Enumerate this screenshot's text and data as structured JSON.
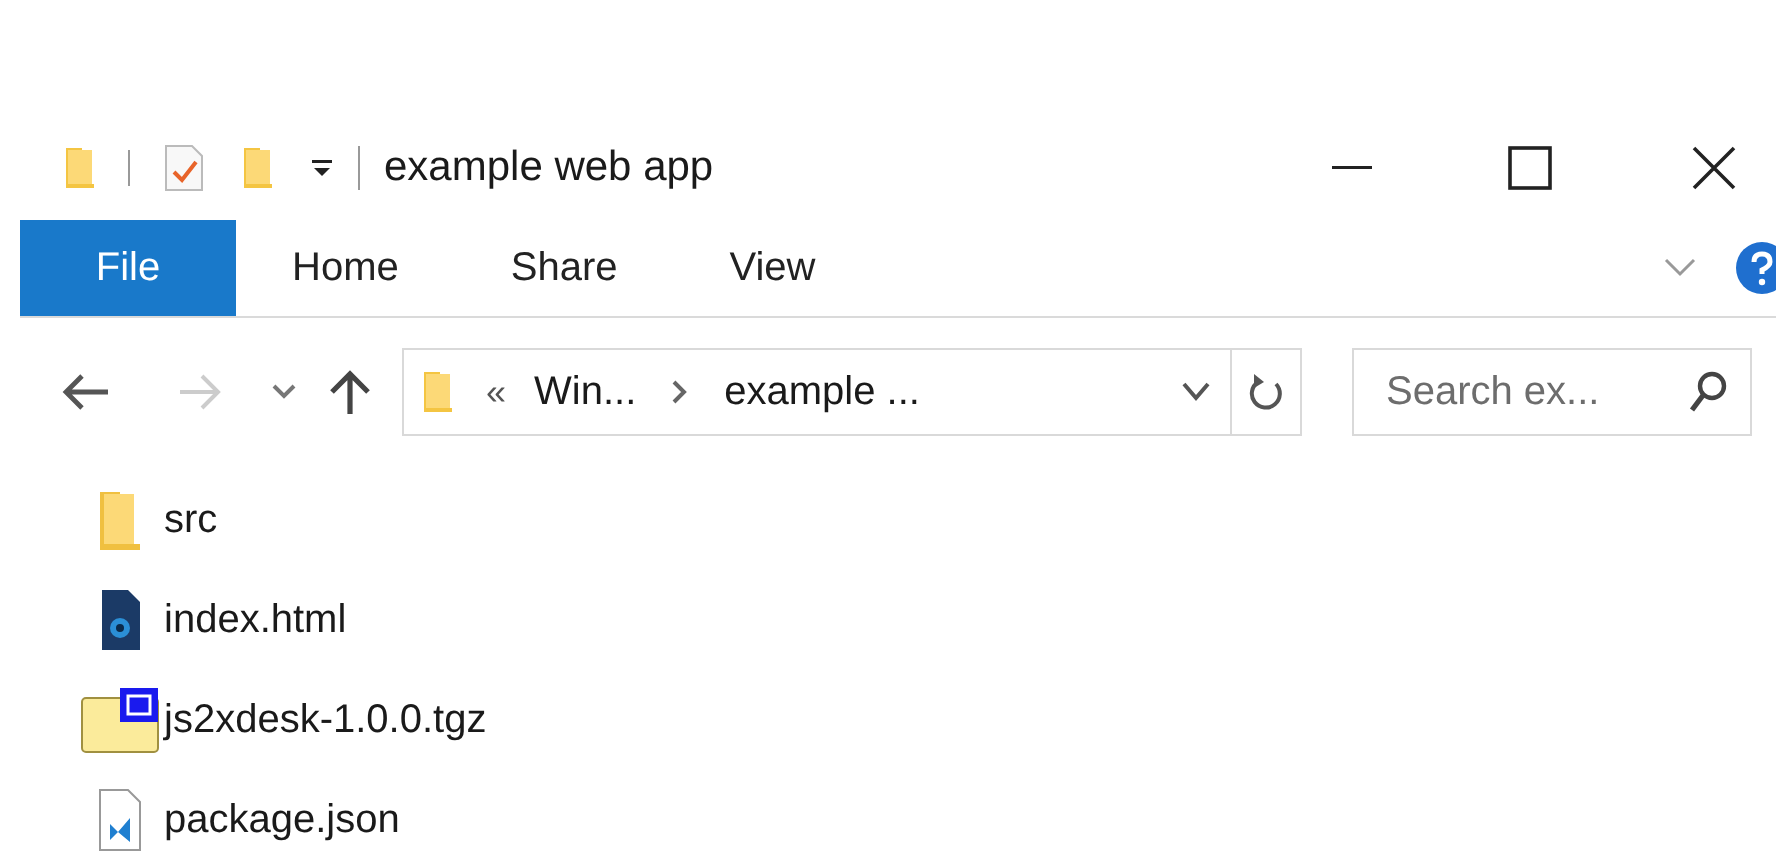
{
  "window": {
    "title": "example web app"
  },
  "ribbon": {
    "tabs": [
      {
        "label": "File",
        "selected": true
      },
      {
        "label": "Home",
        "selected": false
      },
      {
        "label": "Share",
        "selected": false
      },
      {
        "label": "View",
        "selected": false
      }
    ]
  },
  "address": {
    "overflow": "«",
    "crumbs": [
      "Win...",
      "example ..."
    ]
  },
  "search": {
    "placeholder": "Search ex..."
  },
  "files": [
    {
      "name": "src",
      "kind": "folder"
    },
    {
      "name": "index.html",
      "kind": "html"
    },
    {
      "name": "js2xdesk-1.0.0.tgz",
      "kind": "archive"
    },
    {
      "name": "package.json",
      "kind": "json"
    }
  ]
}
